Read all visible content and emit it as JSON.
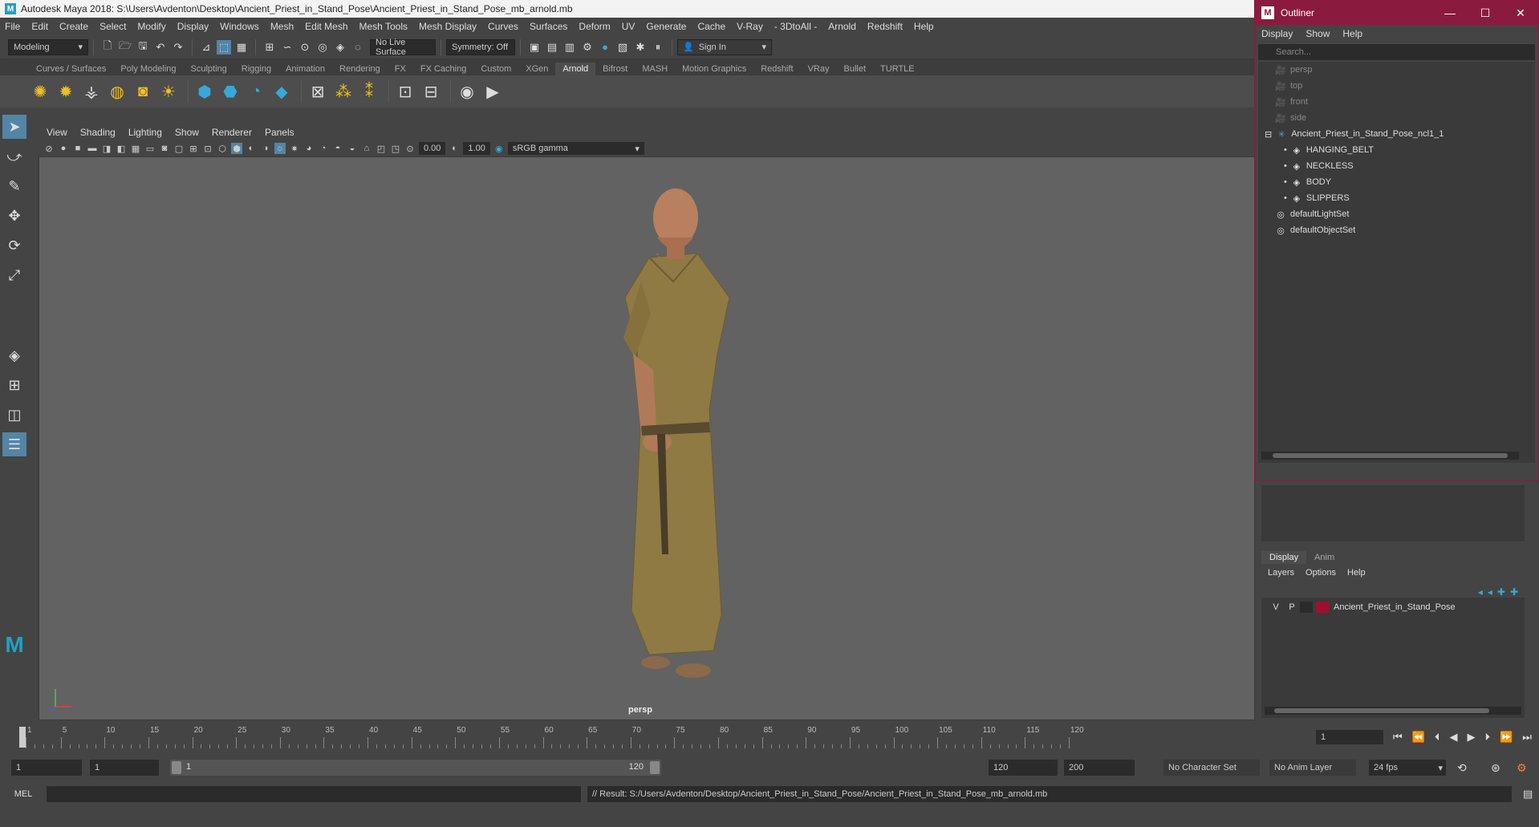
{
  "titlebar": {
    "title": "Autodesk Maya 2018: S:\\Users\\Avdenton\\Desktop\\Ancient_Priest_in_Stand_Pose\\Ancient_Priest_in_Stand_Pose_mb_arnold.mb"
  },
  "menubar": [
    "File",
    "Edit",
    "Create",
    "Select",
    "Modify",
    "Display",
    "Windows",
    "Mesh",
    "Edit Mesh",
    "Mesh Tools",
    "Mesh Display",
    "Curves",
    "Surfaces",
    "Deform",
    "UV",
    "Generate",
    "Cache",
    "V-Ray",
    "- 3DtoAll -",
    "Arnold",
    "Redshift",
    "Help"
  ],
  "statusline": {
    "mode": "Modeling",
    "live_surface": "No Live Surface",
    "symmetry": "Symmetry: Off",
    "sign_in": "Sign In"
  },
  "shelf_tabs": [
    "Curves / Surfaces",
    "Poly Modeling",
    "Sculpting",
    "Rigging",
    "Animation",
    "Rendering",
    "FX",
    "FX Caching",
    "Custom",
    "XGen",
    "Arnold",
    "Bifrost",
    "MASH",
    "Motion Graphics",
    "Redshift",
    "VRay",
    "Bullet",
    "TURTLE"
  ],
  "shelf_active": "Arnold",
  "panel_menu": [
    "View",
    "Shading",
    "Lighting",
    "Show",
    "Renderer",
    "Panels"
  ],
  "panel_toolbar": {
    "exposure": "0.00",
    "gamma": "1.00",
    "color_space": "sRGB gamma"
  },
  "viewport": {
    "camera_label": "persp"
  },
  "outliner": {
    "title": "Outliner",
    "menu": [
      "Display",
      "Show",
      "Help"
    ],
    "search_placeholder": "Search...",
    "items": [
      {
        "label": "persp",
        "dim": true,
        "indent": 1,
        "icon": "camera"
      },
      {
        "label": "top",
        "dim": true,
        "indent": 1,
        "icon": "camera"
      },
      {
        "label": "front",
        "dim": true,
        "indent": 1,
        "icon": "camera"
      },
      {
        "label": "side",
        "dim": true,
        "indent": 1,
        "icon": "camera"
      },
      {
        "label": "Ancient_Priest_in_Stand_Pose_ncl1_1",
        "dim": false,
        "indent": 0,
        "icon": "group"
      },
      {
        "label": "HANGING_BELT",
        "dim": false,
        "indent": 2,
        "icon": "mesh"
      },
      {
        "label": "NECKLESS",
        "dim": false,
        "indent": 2,
        "icon": "mesh"
      },
      {
        "label": "BODY",
        "dim": false,
        "indent": 2,
        "icon": "mesh"
      },
      {
        "label": "SLIPPERS",
        "dim": false,
        "indent": 2,
        "icon": "mesh"
      },
      {
        "label": "defaultLightSet",
        "dim": false,
        "indent": 1,
        "icon": "set"
      },
      {
        "label": "defaultObjectSet",
        "dim": false,
        "indent": 1,
        "icon": "set"
      }
    ]
  },
  "layer_editor": {
    "tabs": [
      "Display",
      "Anim"
    ],
    "menu": [
      "Layers",
      "Options",
      "Help"
    ],
    "layer": {
      "v": "V",
      "p": "P",
      "name": "Ancient_Priest_in_Stand_Pose",
      "color": "#a01030"
    }
  },
  "timeslider": {
    "ticks": [
      "1",
      "5",
      "10",
      "15",
      "20",
      "25",
      "30",
      "35",
      "40",
      "45",
      "50",
      "55",
      "60",
      "65",
      "70",
      "75",
      "80",
      "85",
      "90",
      "95",
      "100",
      "105",
      "110",
      "115",
      "120"
    ],
    "current_frame": "1"
  },
  "rangeslider": {
    "start": "1",
    "playback_start": "1",
    "bar_start": "1",
    "bar_end": "120",
    "playback_end": "120",
    "end": "200",
    "character_set": "No Character Set",
    "anim_layer": "No Anim Layer",
    "fps": "24 fps"
  },
  "cmdline": {
    "label": "MEL",
    "result": "// Result: S:/Users/Avdenton/Desktop/Ancient_Priest_in_Stand_Pose/Ancient_Priest_in_Stand_Pose_mb_arnold.mb"
  },
  "colors": {
    "outliner_accent": "#8a1b3e",
    "active_tool": "#5285a6",
    "shelf_yellow": "#f0c020",
    "shelf_blue": "#38a8d8"
  }
}
